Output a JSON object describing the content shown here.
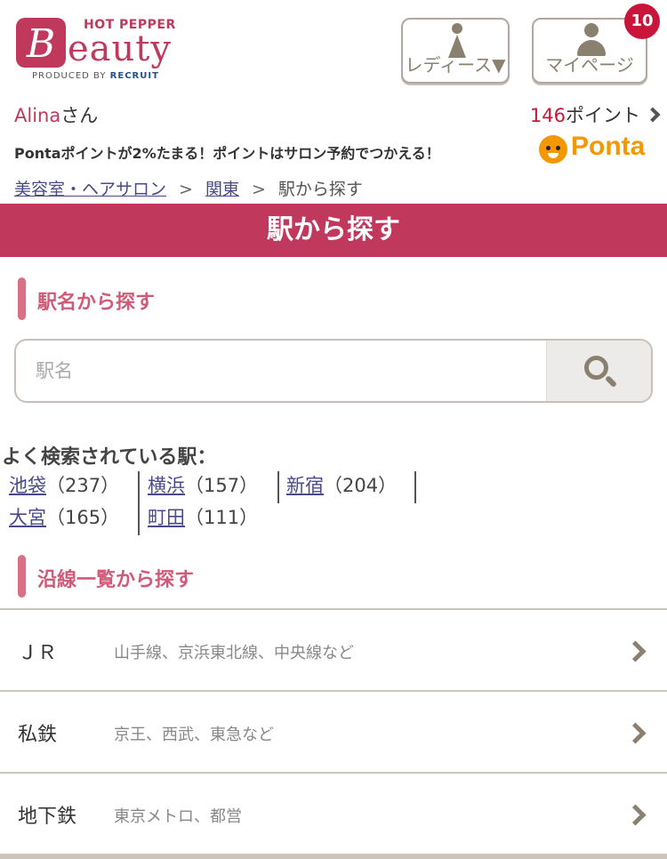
{
  "header": {
    "logo": {
      "hot_pepper": "HOT PEPPER",
      "mark": "B",
      "word": "eauty",
      "produced_by": "PRODUCED BY",
      "recruit": "RECRUIT"
    },
    "ladies_button": "レディース▼",
    "mypage_button": "マイページ",
    "notification_count": "10"
  },
  "user": {
    "name": "Alina",
    "honorific": "さん",
    "points_value": "146",
    "points_label": "ポイント"
  },
  "ponta": {
    "message": "Pontaポイントが2%たまる！ポイントはサロン予約でつかえる！",
    "logo_text": "Ponta"
  },
  "breadcrumb": {
    "items": [
      "美容室・ヘアサロン",
      "関東"
    ],
    "current": "駅から探す",
    "separator": ">"
  },
  "page_title": "駅から探す",
  "station_search": {
    "heading": "駅名から探す",
    "placeholder": "駅名"
  },
  "popular": {
    "title": "よく検索されている駅：",
    "stations": [
      {
        "name": "池袋",
        "count": "（237）"
      },
      {
        "name": "横浜",
        "count": "（157）"
      },
      {
        "name": "新宿",
        "count": "（204）"
      },
      {
        "name": "大宮",
        "count": "（165）"
      },
      {
        "name": "町田",
        "count": "（111）"
      }
    ]
  },
  "lines": {
    "heading": "沿線一覧から探す",
    "items": [
      {
        "name": "ＪＲ",
        "desc": "山手線、京浜東北線、中央線など"
      },
      {
        "name": "私鉄",
        "desc": "京王、西武、東急など"
      },
      {
        "name": "地下鉄",
        "desc": "東京メトロ、都営"
      }
    ]
  },
  "colors": {
    "brand": "#c0395d",
    "badge": "#c8163a",
    "link": "#4a4a8a",
    "ponta": "#f39800"
  }
}
